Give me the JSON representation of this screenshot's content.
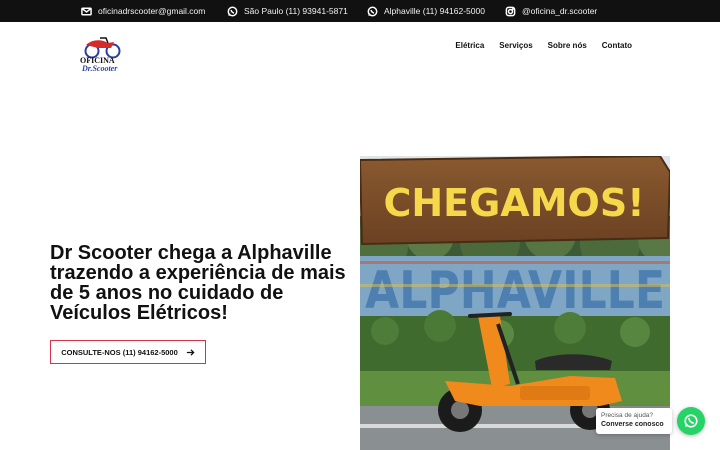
{
  "topbar": {
    "email": "oficinadrscooter@gmail.com",
    "phone_sp": "São Paulo (11) 93941-5871",
    "phone_alphaville": "Alphaville (11) 94162-5000",
    "instagram": "@oficina_dr.scooter"
  },
  "logo": {
    "line1": "OFICINA",
    "line2": "Dr.Scooter"
  },
  "nav": {
    "items": [
      "Elétrica",
      "Serviços",
      "Sobre nós",
      "Contato"
    ]
  },
  "hero": {
    "title": "Dr Scooter chega a Alphaville trazendo a experiência de mais de 5 anos no cuidado de Veículos Elétricos!",
    "cta_label": "CONSULTE-NOS (11) 94162-5000",
    "image_sign_text": "CHEGAMOS!",
    "image_letters_text": "ALPHAVILLE"
  },
  "chat": {
    "prompt": "Precisa de ajuda?",
    "action": "Converse conosco"
  },
  "colors": {
    "topbar_bg": "#111111",
    "cta_border": "#d8324a",
    "whatsapp": "#25d366",
    "sign_text": "#f6d84a",
    "scooter_orange": "#f08a1c"
  }
}
